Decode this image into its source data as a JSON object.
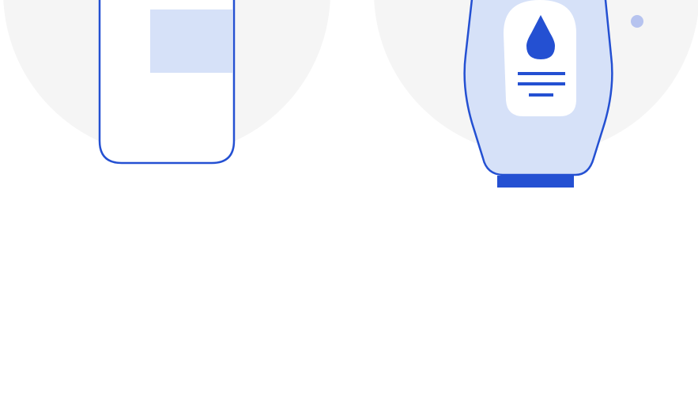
{
  "illustrations": [
    {
      "name": "phone",
      "icon": "phone-illustration-icon"
    },
    {
      "name": "lotion-bottle",
      "icon": "lotion-bottle-illustration-icon",
      "label_icon": "water-drop-icon"
    }
  ],
  "colors": {
    "background": "#ffffff",
    "circle": "#f5f5f5",
    "outline": "#2450d2",
    "fill_light": "#d6e1f8",
    "dot": "#b6c3ef",
    "white": "#ffffff"
  }
}
